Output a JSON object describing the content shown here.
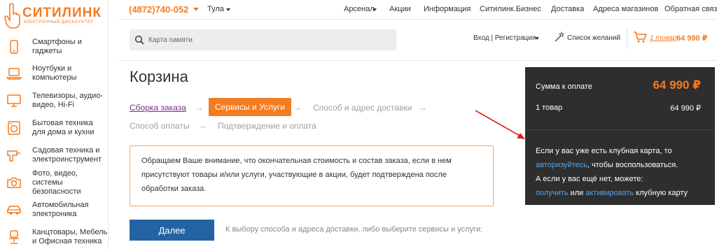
{
  "brand": {
    "name": "СИТИЛИНК",
    "tagline": "электронный дискаунтер",
    "color": "#f47c20"
  },
  "sidebar": {
    "categories": [
      {
        "label": "Смартфоны и гаджеты",
        "icon": "smartphone-icon"
      },
      {
        "label": "Ноутбуки и компьютеры",
        "icon": "laptop-icon"
      },
      {
        "label": "Телевизоры, аудио-видео, Hi-Fi",
        "icon": "tv-icon"
      },
      {
        "label": "Бытовая техника для дома и кухни",
        "icon": "washing-machine-icon"
      },
      {
        "label": "Садовая техника и электроинструмент",
        "icon": "drill-icon"
      },
      {
        "label": "Фото, видео, системы безопасности",
        "icon": "camera-icon"
      },
      {
        "label": "Автомобильная электроника",
        "icon": "car-icon"
      },
      {
        "label": "Канцтовары, Мебель и Офисная техника",
        "icon": "chair-icon"
      }
    ]
  },
  "topbar": {
    "phone": "(4872)740-052",
    "city": "Тула",
    "nav": [
      "Арсенал",
      "Акции",
      "Информация",
      "Ситилинк.Бизнес",
      "Доставка",
      "Адреса магазинов",
      "Обратная связь"
    ]
  },
  "search": {
    "placeholder": "Карта памяти"
  },
  "account": {
    "login": "Вход",
    "register": "Регистрация",
    "wishlist": "Список желаний",
    "cart_items": "1 товар",
    "cart_total": "64 990 ₽"
  },
  "page": {
    "title": "Корзина",
    "steps": {
      "s1": "Сборка заказа",
      "s2": "Сервисы и Услуги",
      "s3": "Способ и адрес доставки",
      "s4": "Способ оплаты",
      "s5": "Подтверждение и оплата"
    },
    "arrow": "→",
    "notice": "Обращаем Ваше внимание, что окончательная стоимость и состав заказа, если в нем присутствуют товары и/или услуги, участвующие в акции, будет подтверждена после обработки заказа.",
    "next_button": "Далее",
    "next_hint": "К выбору способа и адреса доставки, либо выберите сервисы и услуги:"
  },
  "summary": {
    "total_label": "Сумма к оплате",
    "total_value": "64 990 ₽",
    "items_label": "1 товар",
    "items_value": "64 990 ₽",
    "club": {
      "t1": "Если у вас уже есть клубная карта, то",
      "link1": "авторизуйтесь",
      "t2": ", чтобы воспользоваться.",
      "t3": "А если у вас ещё нет, можете:",
      "link2": "получить",
      "t4": "или",
      "link3": "активировать",
      "t5": "клубную карту"
    }
  },
  "colors": {
    "accent": "#f47c20",
    "button": "#2363a3",
    "panel": "#2e2e2e",
    "link": "#5aa2e8",
    "visited": "#7b2a8a",
    "annotation": "#e02020"
  }
}
